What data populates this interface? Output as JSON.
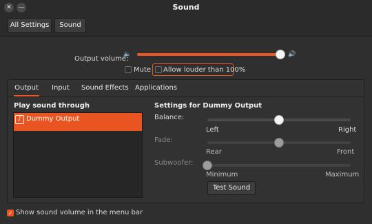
{
  "window": {
    "title": "Sound",
    "close_glyph": "✕",
    "minimize_glyph": "—"
  },
  "toolbar": {
    "all_settings": "All Settings",
    "sound": "Sound"
  },
  "output_volume": {
    "label": "Output volume:",
    "level": 0.98,
    "mute_label": "Mute",
    "mute_checked": false,
    "louder_label": "Allow louder than 100%",
    "louder_checked": false
  },
  "tabs": [
    "Output",
    "Input",
    "Sound Effects",
    "Applications"
  ],
  "active_tab": "Output",
  "output_panel": {
    "play_through_heading": "Play sound through",
    "devices": [
      {
        "name": "Dummy Output",
        "selected": true
      }
    ],
    "settings_heading": "Settings for Dummy Output",
    "balance": {
      "label": "Balance:",
      "left": "Left",
      "right": "Right",
      "value": 0.5
    },
    "fade": {
      "label": "Fade:",
      "left": "Rear",
      "right": "Front",
      "value": 0.5,
      "enabled": false
    },
    "subwoofer": {
      "label": "Subwoofer:",
      "left": "Minimum",
      "right": "Maximum",
      "value": 0.0,
      "enabled": false
    },
    "test_button": "Test Sound"
  },
  "footer": {
    "menu_bar_label": "Show sound volume in the menu bar",
    "menu_bar_checked": true
  },
  "colors": {
    "accent": "#e95420",
    "background": "#2f2f2f"
  }
}
